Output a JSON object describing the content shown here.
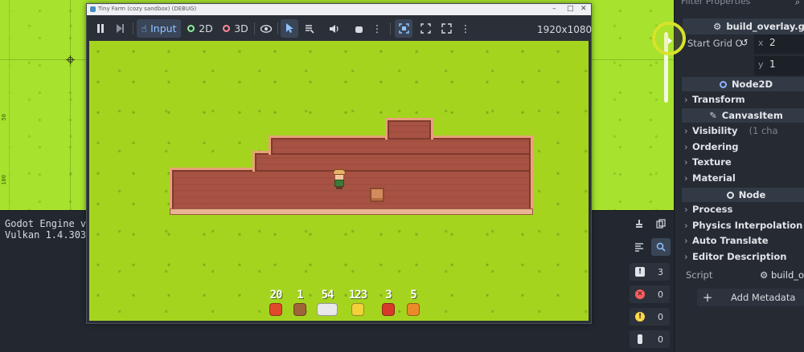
{
  "editor": {
    "ruler_marks": [
      "50",
      "100"
    ]
  },
  "output": {
    "lines": [
      "Godot Engine v4.",
      "Vulkan 1.4.303 -"
    ],
    "counts": {
      "errors_total": "3",
      "errors": "0",
      "warnings": "0",
      "info": "0"
    }
  },
  "inspector": {
    "filter_placeholder": "Filter Properties",
    "script_file": "build_overlay.gd",
    "start_grid_label": "Start Grid O",
    "start_grid": {
      "x": "2",
      "y": "1"
    },
    "sections": {
      "node2d": "Node2D",
      "canvas_item": "CanvasItem",
      "node": "Node"
    },
    "categories": {
      "transform": "Transform",
      "visibility": "Visibility",
      "visibility_hint": "(1 cha",
      "ordering": "Ordering",
      "texture": "Texture",
      "material": "Material",
      "process": "Process",
      "physics_interpolation": "Physics Interpolation",
      "auto_translate": "Auto Translate",
      "editor_description": "Editor Description"
    },
    "script_label": "Script",
    "script_value": "build_ove",
    "add_metadata": "Add Metadata"
  },
  "game_window": {
    "title": "Tiny Farm (cozy sandbox) (DEBUG)",
    "toolbar": {
      "input_label": "Input",
      "mode_2d": "2D",
      "mode_3d": "3D",
      "resolution": "1920x1080"
    },
    "hud": [
      {
        "value": "20",
        "item": "apple",
        "color": "#e04a2a"
      },
      {
        "value": "1",
        "item": "wood",
        "color": "#a0643a"
      },
      {
        "value": "54",
        "item": "fish",
        "color": "#e8e8ea"
      },
      {
        "value": "123",
        "item": "corn",
        "color": "#f2d23a"
      },
      {
        "value": "3",
        "item": "tomato",
        "color": "#d83a2a"
      },
      {
        "value": "5",
        "item": "pumpkin",
        "color": "#ec8a2a"
      }
    ]
  }
}
